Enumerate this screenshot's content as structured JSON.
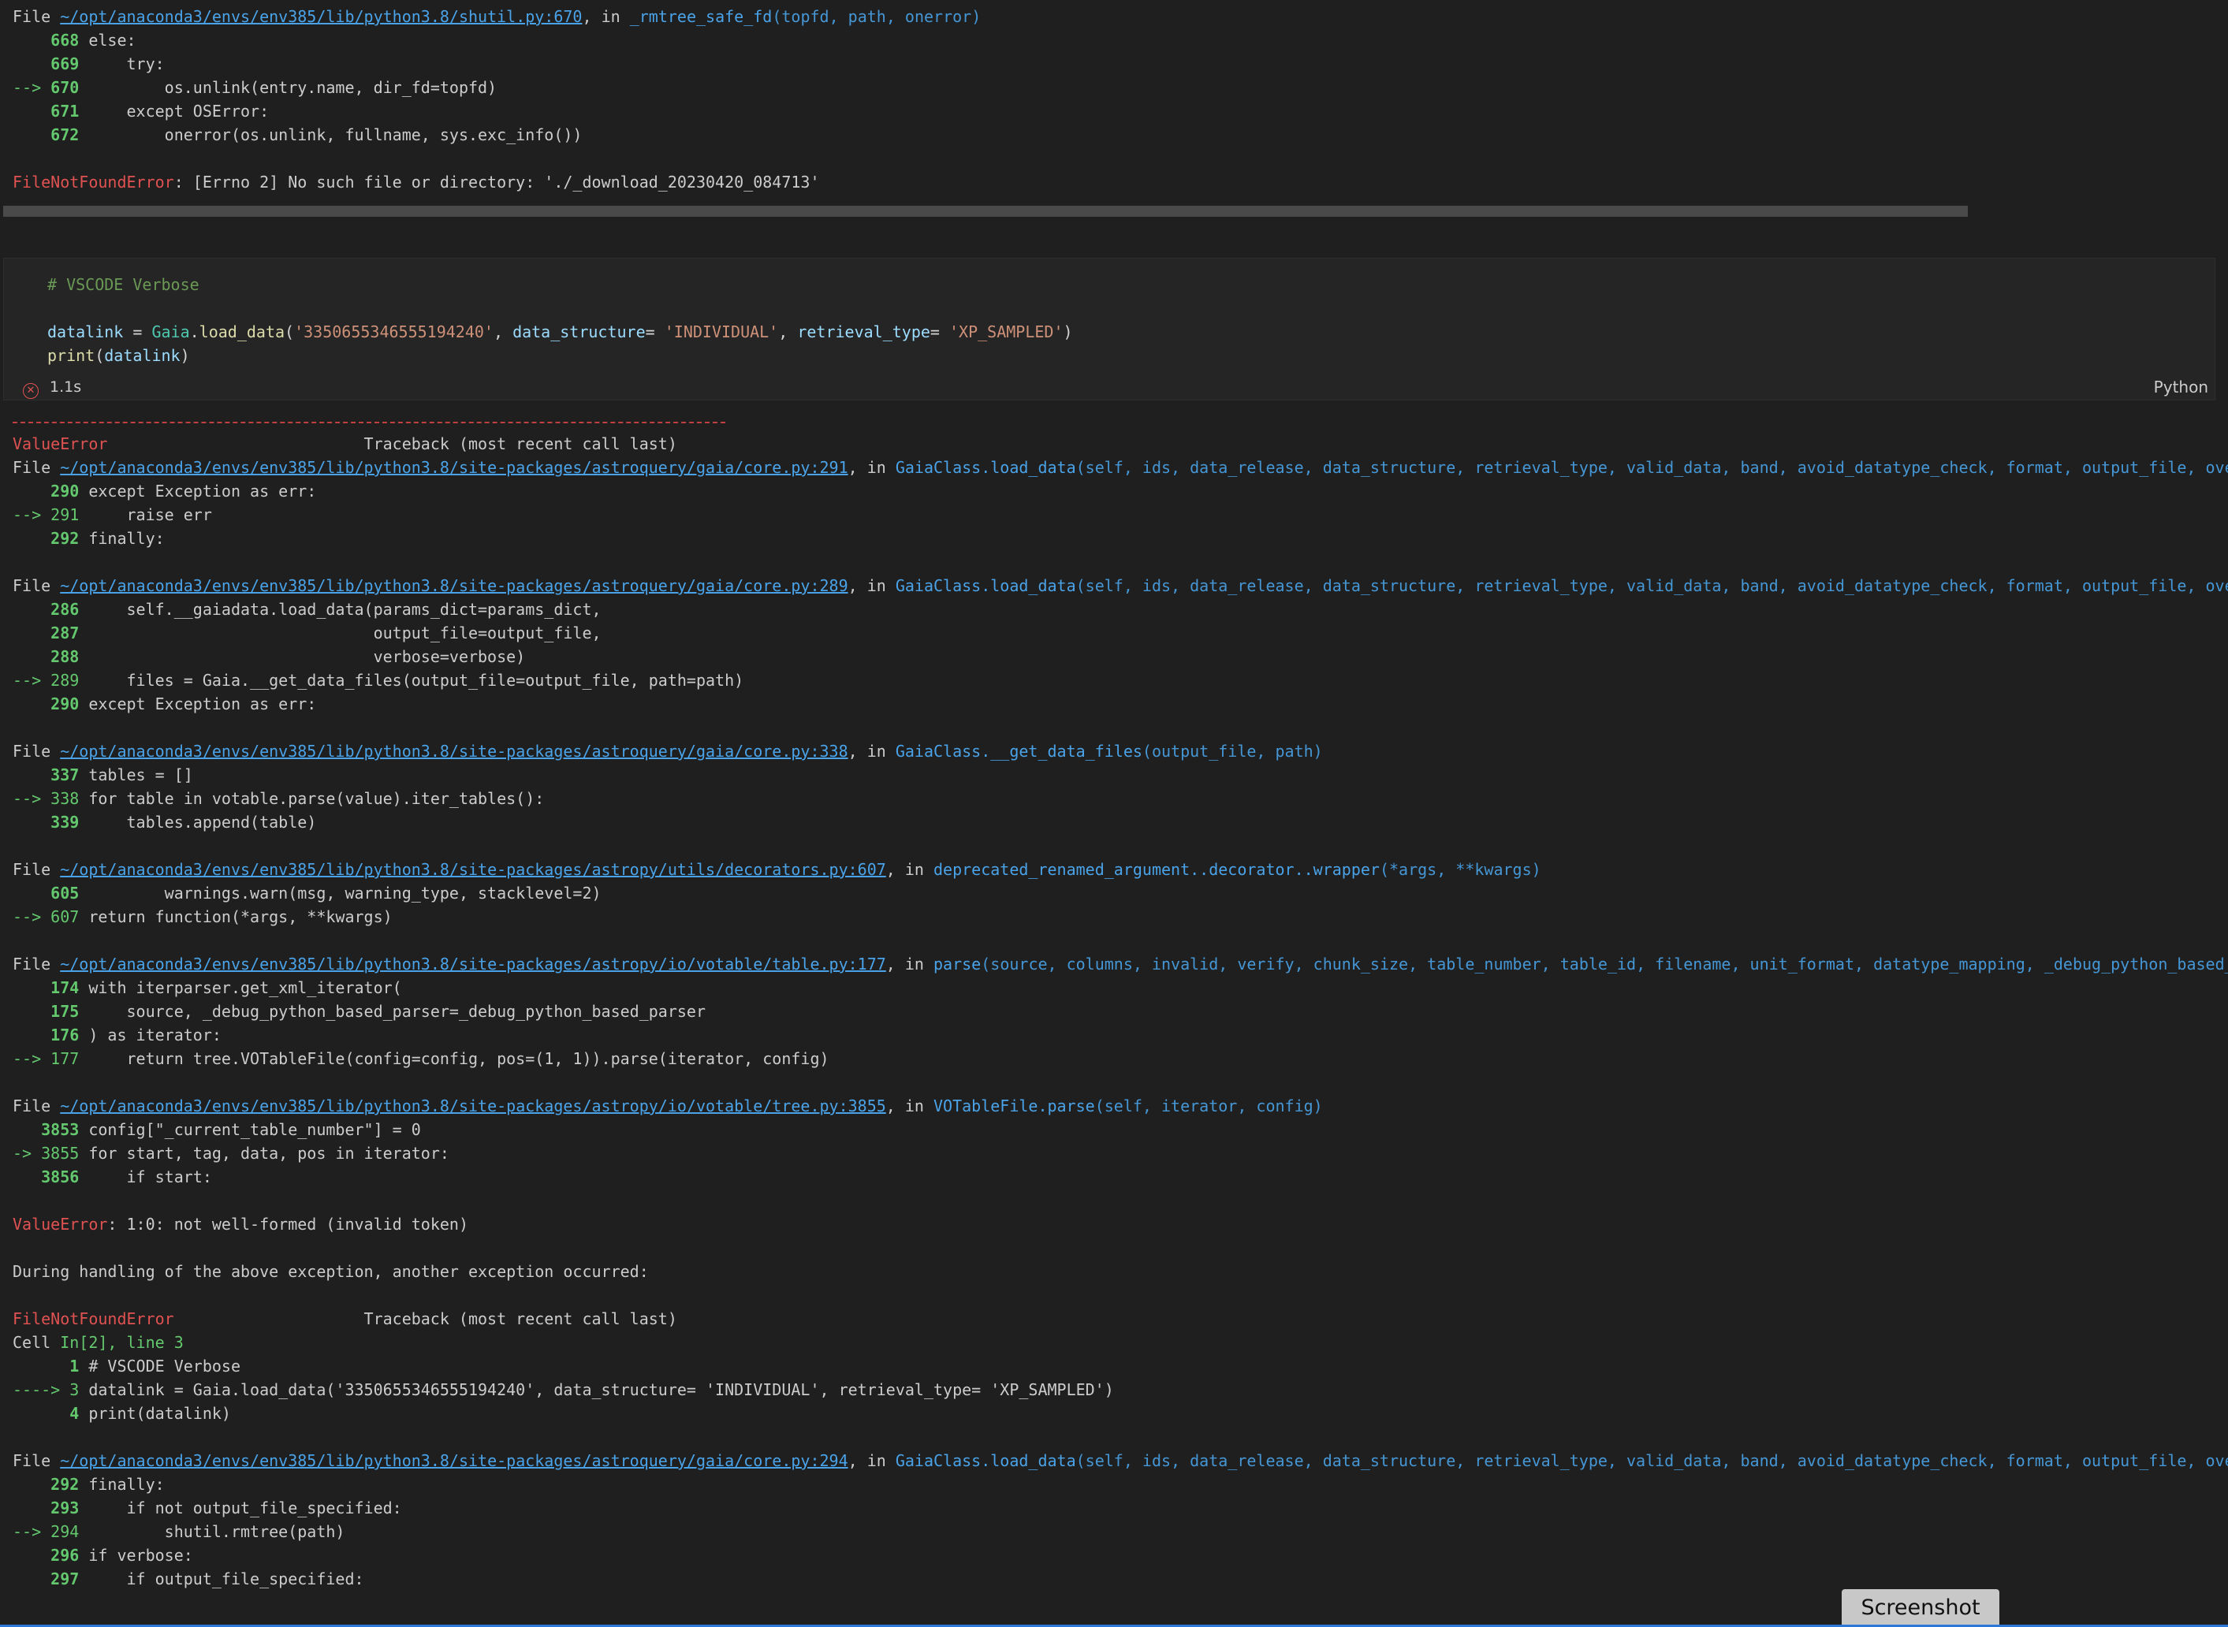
{
  "top_trace": {
    "file_prefix": "File ",
    "file_link": "~/opt/anaconda3/envs/env385/lib/python3.8/shutil.py:670",
    "in_text": ", in ",
    "func": "_rmtree_safe_fd",
    "args": "(topfd, path, onerror)",
    "lines": [
      {
        "marker": "    ",
        "num": "668",
        "code": " else:"
      },
      {
        "marker": "    ",
        "num": "669",
        "code": "     try:"
      },
      {
        "marker": "--> ",
        "num": "670",
        "code": "         os.unlink(entry.name, dir_fd=topfd)"
      },
      {
        "marker": "    ",
        "num": "671",
        "code": "     except OSError:"
      },
      {
        "marker": "    ",
        "num": "672",
        "code": "         onerror(os.unlink, fullname, sys.exc_info())"
      }
    ],
    "error_name": "FileNotFoundError",
    "error_msg": ": [Errno 2] No such file or directory: './_download_20230420_084713'"
  },
  "cell": {
    "comment": "# VSCODE Verbose",
    "code_line2": {
      "var": "datalink",
      "eq": " = ",
      "cls": "Gaia",
      "dot": ".",
      "func": "load_data",
      "p1": "(",
      "s1": "'3350655346555194240'",
      "c1": ", ",
      "k1": "data_structure",
      "e1": "= ",
      "s2": "'INDIVIDUAL'",
      "c2": ", ",
      "k2": "retrieval_type",
      "e2": "= ",
      "s3": "'XP_SAMPLED'",
      "p2": ")"
    },
    "code_line3": {
      "func": "print",
      "p1": "(",
      "var": "datalink",
      "p2": ")"
    },
    "status_time": "1.1s",
    "language": "Python"
  },
  "output": [
    {
      "type": "header",
      "err": "ValueError",
      "rest": "                           Traceback (most recent call last)"
    },
    {
      "type": "file",
      "link": "~/opt/anaconda3/envs/env385/lib/python3.8/site-packages/astroquery/gaia/core.py:291",
      "func": "GaiaClass.load_data",
      "args": "(self, ids, data_release, data_structure, retrieval_type, valid_data, band, avoid_datatype_check, format, output_file, overwrite_output_file, verbose)"
    },
    {
      "type": "code",
      "marker": "    ",
      "num": "290",
      "code": " except Exception as err:"
    },
    {
      "type": "code",
      "marker": "--> ",
      "num": "291",
      "code": "     raise err",
      "current": true
    },
    {
      "type": "code",
      "marker": "    ",
      "num": "292",
      "code": " finally:"
    },
    {
      "type": "blank"
    },
    {
      "type": "file",
      "link": "~/opt/anaconda3/envs/env385/lib/python3.8/site-packages/astroquery/gaia/core.py:289",
      "func": "GaiaClass.load_data",
      "args": "(self, ids, data_release, data_structure, retrieval_type, valid_data, band, avoid_datatype_check, format, output_file, overwrite_output_file, verbose)"
    },
    {
      "type": "code",
      "marker": "    ",
      "num": "286",
      "code": "     self.__gaiadata.load_data(params_dict=params_dict,"
    },
    {
      "type": "code",
      "marker": "    ",
      "num": "287",
      "code": "                               output_file=output_file,"
    },
    {
      "type": "code",
      "marker": "    ",
      "num": "288",
      "code": "                               verbose=verbose)"
    },
    {
      "type": "code",
      "marker": "--> ",
      "num": "289",
      "code": "     files = Gaia.__get_data_files(output_file=output_file, path=path)",
      "current": true
    },
    {
      "type": "code",
      "marker": "    ",
      "num": "290",
      "code": " except Exception as err:"
    },
    {
      "type": "blank"
    },
    {
      "type": "file",
      "link": "~/opt/anaconda3/envs/env385/lib/python3.8/site-packages/astroquery/gaia/core.py:338",
      "func": "GaiaClass.__get_data_files",
      "args": "(output_file, path)"
    },
    {
      "type": "code",
      "marker": "    ",
      "num": "337",
      "code": " tables = []"
    },
    {
      "type": "code",
      "marker": "--> ",
      "num": "338",
      "code": " for table in votable.parse(value).iter_tables():",
      "current": true
    },
    {
      "type": "code",
      "marker": "    ",
      "num": "339",
      "code": "     tables.append(table)"
    },
    {
      "type": "blank"
    },
    {
      "type": "file",
      "link": "~/opt/anaconda3/envs/env385/lib/python3.8/site-packages/astropy/utils/decorators.py:607",
      "func": "deprecated_renamed_argument..decorator..wrapper",
      "args": "(*args, **kwargs)"
    },
    {
      "type": "code",
      "marker": "    ",
      "num": "605",
      "code": "         warnings.warn(msg, warning_type, stacklevel=2)"
    },
    {
      "type": "code",
      "marker": "--> ",
      "num": "607",
      "code": " return function(*args, **kwargs)",
      "current": true
    },
    {
      "type": "blank"
    },
    {
      "type": "file",
      "link": "~/opt/anaconda3/envs/env385/lib/python3.8/site-packages/astropy/io/votable/table.py:177",
      "func": "parse",
      "args": "(source, columns, invalid, verify, chunk_size, table_number, table_id, filename, unit_format, datatype_mapping, _debug_python_based_parser)"
    },
    {
      "type": "code",
      "marker": "    ",
      "num": "174",
      "code": " with iterparser.get_xml_iterator("
    },
    {
      "type": "code",
      "marker": "    ",
      "num": "175",
      "code": "     source, _debug_python_based_parser=_debug_python_based_parser"
    },
    {
      "type": "code",
      "marker": "    ",
      "num": "176",
      "code": " ) as iterator:"
    },
    {
      "type": "code",
      "marker": "--> ",
      "num": "177",
      "code": "     return tree.VOTableFile(config=config, pos=(1, 1)).parse(iterator, config)",
      "current": true
    },
    {
      "type": "blank"
    },
    {
      "type": "file",
      "link": "~/opt/anaconda3/envs/env385/lib/python3.8/site-packages/astropy/io/votable/tree.py:3855",
      "func": "VOTableFile.parse",
      "args": "(self, iterator, config)"
    },
    {
      "type": "code",
      "marker": "   ",
      "num": "3853",
      "code": " config[\"_current_table_number\"] = 0"
    },
    {
      "type": "code",
      "marker": "-> ",
      "num": "3855",
      "code": " for start, tag, data, pos in iterator:",
      "current": true
    },
    {
      "type": "code",
      "marker": "   ",
      "num": "3856",
      "code": "     if start:"
    },
    {
      "type": "blank"
    },
    {
      "type": "error",
      "err": "ValueError",
      "rest": ": 1:0: not well-formed (invalid token)"
    },
    {
      "type": "blank"
    },
    {
      "type": "text",
      "text": "During handling of the above exception, another exception occurred:"
    },
    {
      "type": "blank"
    },
    {
      "type": "header",
      "err": "FileNotFoundError",
      "rest": "                    Traceback (most recent call last)"
    },
    {
      "type": "cell",
      "prefix": "Cell ",
      "ref": "In[2], line 3"
    },
    {
      "type": "code",
      "marker": "      ",
      "num": "1",
      "code": " # VSCODE Verbose"
    },
    {
      "type": "code",
      "marker": "----> ",
      "num": "3",
      "code": " datalink = Gaia.load_data('3350655346555194240', data_structure= 'INDIVIDUAL', retrieval_type= 'XP_SAMPLED')",
      "current": true
    },
    {
      "type": "code",
      "marker": "      ",
      "num": "4",
      "code": " print(datalink)"
    },
    {
      "type": "blank"
    },
    {
      "type": "file",
      "link": "~/opt/anaconda3/envs/env385/lib/python3.8/site-packages/astroquery/gaia/core.py:294",
      "func": "GaiaClass.load_data",
      "args": "(self, ids, data_release, data_structure, retrieval_type, valid_data, band, avoid_datatype_check, format, output_file, overwrite_output_file, verbose)"
    },
    {
      "type": "code",
      "marker": "    ",
      "num": "292",
      "code": " finally:"
    },
    {
      "type": "code",
      "marker": "    ",
      "num": "293",
      "code": "     if not output_file_specified:"
    },
    {
      "type": "code",
      "marker": "--> ",
      "num": "294",
      "code": "         shutil.rmtree(path)",
      "current": true
    },
    {
      "type": "code",
      "marker": "    ",
      "num": "296",
      "code": " if verbose:"
    },
    {
      "type": "code",
      "marker": "    ",
      "num": "297",
      "code": "     if output_file_specified:"
    }
  ],
  "file_prefix": "File ",
  "in_text": ", in ",
  "screenshot_button": "Screenshot"
}
